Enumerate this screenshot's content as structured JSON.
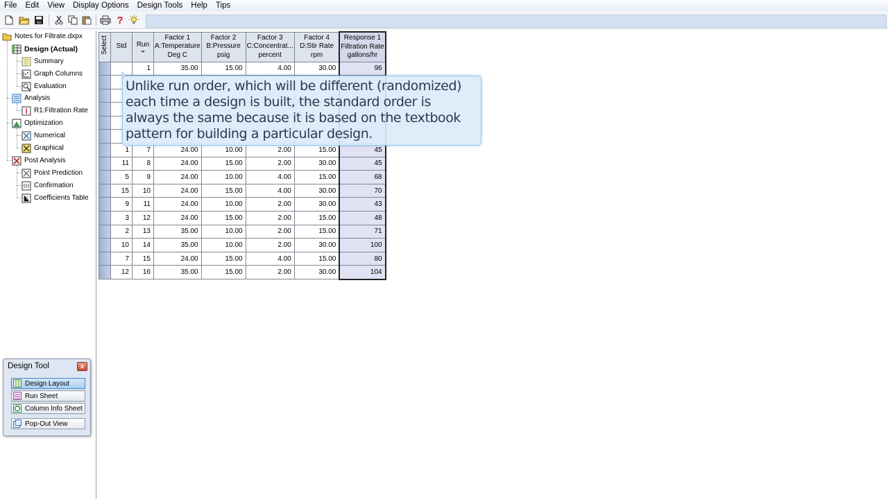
{
  "menu": [
    "File",
    "Edit",
    "View",
    "Display Options",
    "Design Tools",
    "Help",
    "Tips"
  ],
  "tree": {
    "root": "Notes for Filtrate.dxpx",
    "design": "Design (Actual)",
    "summary": "Summary",
    "graph_columns": "Graph Columns",
    "evaluation": "Evaluation",
    "analysis": "Analysis",
    "r1": "R1:Filtration Rate",
    "optimization": "Optimization",
    "numerical": "Numerical",
    "graphical": "Graphical",
    "post_analysis": "Post Analysis",
    "point_prediction": "Point Prediction",
    "confirmation": "Confirmation",
    "coefficients_table": "Coefficients Table"
  },
  "grid": {
    "headers": {
      "select": "Select",
      "std": "Std",
      "run": "Run",
      "f1": [
        "Factor 1",
        "A:Temperature",
        "Deg C"
      ],
      "f2": [
        "Factor 2",
        "B:Pressure",
        "psig"
      ],
      "f3": [
        "Factor 3",
        "C:Concentrat...",
        "percent"
      ],
      "f4": [
        "Factor 4",
        "D:Stir Rate",
        "rpm"
      ],
      "r1": [
        "Response 1",
        "Filtration Rate",
        "gallons/hr"
      ]
    },
    "rows": [
      [
        "",
        "1",
        "35.00",
        "15.00",
        "4.00",
        "30.00",
        "96"
      ],
      [
        "",
        "",
        "",
        "",
        "",
        "",
        ""
      ],
      [
        "",
        "",
        "",
        "",
        "",
        "",
        ""
      ],
      [
        "",
        "",
        "",
        "",
        "",
        "",
        ""
      ],
      [
        "",
        "",
        "",
        "",
        "",
        "",
        ""
      ],
      [
        "",
        "",
        "",
        "",
        "",
        "",
        ""
      ],
      [
        "1",
        "7",
        "24.00",
        "10.00",
        "2.00",
        "15.00",
        "45"
      ],
      [
        "11",
        "8",
        "24.00",
        "15.00",
        "2.00",
        "30.00",
        "45"
      ],
      [
        "5",
        "9",
        "24.00",
        "10.00",
        "4.00",
        "15.00",
        "68"
      ],
      [
        "15",
        "10",
        "24.00",
        "15.00",
        "4.00",
        "30.00",
        "70"
      ],
      [
        "9",
        "11",
        "24.00",
        "10.00",
        "2.00",
        "30.00",
        "43"
      ],
      [
        "3",
        "12",
        "24.00",
        "15.00",
        "2.00",
        "15.00",
        "48"
      ],
      [
        "2",
        "13",
        "35.00",
        "10.00",
        "2.00",
        "15.00",
        "71"
      ],
      [
        "10",
        "14",
        "35.00",
        "10.00",
        "2.00",
        "30.00",
        "100"
      ],
      [
        "7",
        "15",
        "24.00",
        "15.00",
        "4.00",
        "15.00",
        "80"
      ],
      [
        "12",
        "16",
        "35.00",
        "15.00",
        "2.00",
        "30.00",
        "104"
      ]
    ]
  },
  "callout": {
    "lines": [
      "Unlike run order, which will be different (randomized)",
      "each time a design is built, the standard order is",
      "always the same because it is based on the textbook",
      "pattern for building a particular design."
    ]
  },
  "design_tool": {
    "title": "Design Tool",
    "close": "x",
    "buttons": [
      "Design Layout",
      "Run Sheet",
      "Column Info Sheet",
      "Pop-Out View"
    ]
  },
  "toolbar_icons": [
    "new-file-icon",
    "open-folder-icon",
    "save-icon",
    "cut-icon",
    "copy-icon",
    "paste-icon",
    "print-icon",
    "help-icon",
    "tip-bulb-icon"
  ],
  "toolbar_glyphs": {
    "help": "?"
  }
}
